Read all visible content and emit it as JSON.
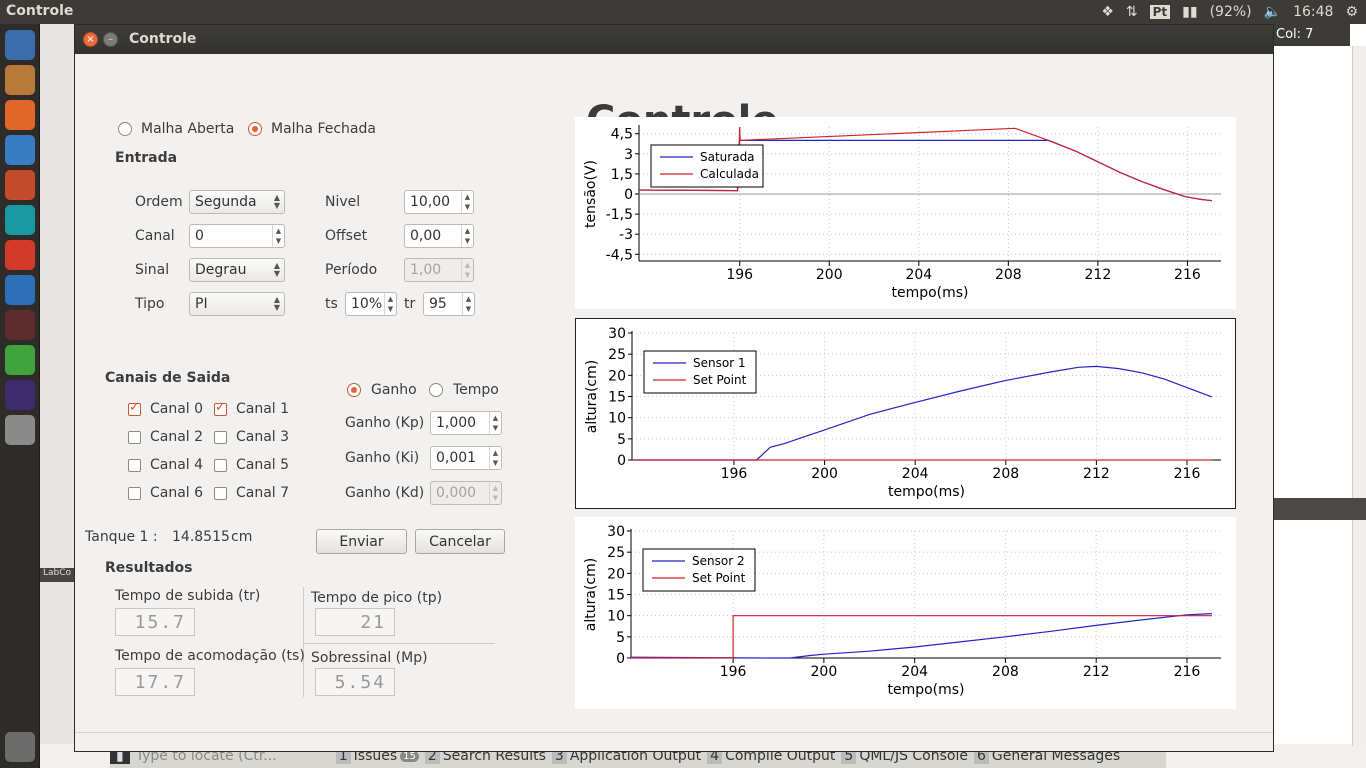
{
  "topbar": {
    "app_title": "Controle",
    "keyboard": "Pt",
    "battery": "(92%)",
    "clock": "16:48"
  },
  "bg": {
    "col_indicator": "Col: 7",
    "launcher_label": "LabCo"
  },
  "bottom_panel": {
    "locate_placeholder": "Type to locate (Ctr...",
    "tabs": [
      {
        "num": "1",
        "label": "Issues",
        "badge": "15"
      },
      {
        "num": "2",
        "label": "Search Results"
      },
      {
        "num": "3",
        "label": "Application Output"
      },
      {
        "num": "4",
        "label": "Compile Output"
      },
      {
        "num": "5",
        "label": "QML/JS Console"
      },
      {
        "num": "6",
        "label": "General Messages"
      }
    ]
  },
  "window": {
    "title": "Controle",
    "close_glyph": "×",
    "min_glyph": "–"
  },
  "form": {
    "big_title": "Controle",
    "mode_open": "Malha Aberta",
    "mode_closed": "Malha Fechada",
    "entrada": "Entrada",
    "ordem_label": "Ordem",
    "ordem_value": "Segunda",
    "canal_label": "Canal",
    "canal_value": "0",
    "sinal_label": "Sinal",
    "sinal_value": "Degrau",
    "tipo_label": "Tipo",
    "tipo_value": "PI",
    "nivel_label": "Nivel",
    "nivel_value": "10,00",
    "offset_label": "Offset",
    "offset_value": "0,00",
    "periodo_label": "Período",
    "periodo_value": "1,00",
    "ts_label": "ts",
    "ts_value": "10%",
    "tr_label": "tr",
    "tr_value": "95",
    "canais_title": "Canais de Saida",
    "canais": [
      "Canal 0",
      "Canal 1",
      "Canal 2",
      "Canal 3",
      "Canal 4",
      "Canal 5",
      "Canal 6",
      "Canal 7"
    ],
    "ganho_radio": "Ganho",
    "tempo_radio": "Tempo",
    "kp_label": "Ganho (Kp)",
    "kp_value": "1,000",
    "ki_label": "Ganho (Ki)",
    "ki_value": "0,001",
    "kd_label": "Ganho (Kd)",
    "kd_value": "0,000",
    "tanque_label": "Tanque 1 :",
    "tanque_value": "14.8515",
    "tanque_unit": "cm",
    "enviar": "Enviar",
    "cancelar": "Cancelar",
    "resultados": "Resultados",
    "tr_res_label": "Tempo de subida (tr)",
    "tr_res_value": "15.7",
    "tp_res_label": "Tempo de pico (tp)",
    "tp_res_value": "21",
    "ts_res_label": "Tempo de acomodação (ts)",
    "ts_res_value": "17.7",
    "mp_res_label": "Sobressinal (Mp)",
    "mp_res_value": "5.54"
  },
  "chart_data": [
    {
      "type": "line",
      "xlabel": "tempo(ms)",
      "ylabel": "tensão(V)",
      "xlim": [
        191.5,
        217.5
      ],
      "ylim": [
        -5,
        5
      ],
      "xticks": [
        196,
        200,
        204,
        208,
        212,
        216
      ],
      "yticks": [
        -4.5,
        -3,
        -1.5,
        0,
        1.5,
        3,
        4.5
      ],
      "ytick_labels": [
        "-4,5",
        "-3",
        "-1,5",
        "0",
        "1,5",
        "3",
        "4,5"
      ],
      "legend_position": "top-left",
      "series": [
        {
          "name": "Saturada",
          "color": "#2424c8",
          "x": [
            191.5,
            195.9,
            196.0,
            209.8,
            211,
            212,
            213,
            214,
            215,
            215.9,
            216.6,
            217.1
          ],
          "y": [
            0.3,
            0.25,
            4.0,
            4.0,
            3.2,
            2.4,
            1.6,
            0.9,
            0.3,
            -0.2,
            -0.4,
            -0.5
          ]
        },
        {
          "name": "Calculada",
          "color": "#cc2233",
          "x": [
            191.5,
            195.9,
            196.0,
            196.02,
            208.3,
            209.8,
            211,
            212,
            213,
            214,
            215,
            215.9,
            216.6,
            217.1
          ],
          "y": [
            0.3,
            0.25,
            5.0,
            4.0,
            4.9,
            4.0,
            3.2,
            2.4,
            1.6,
            0.9,
            0.3,
            -0.2,
            -0.4,
            -0.5
          ]
        }
      ]
    },
    {
      "type": "line",
      "xlabel": "tempo(ms)",
      "ylabel": "altura(cm)",
      "xlim": [
        191.5,
        217.5
      ],
      "ylim": [
        0,
        30
      ],
      "xticks": [
        196,
        200,
        204,
        208,
        212,
        216
      ],
      "yticks": [
        0,
        5,
        10,
        15,
        20,
        25,
        30
      ],
      "legend_position": "top-left",
      "series": [
        {
          "name": "Sensor 1",
          "color": "#2424c8",
          "x": [
            191.5,
            197.0,
            197.6,
            198.3,
            199,
            200,
            202,
            204,
            206,
            208,
            210,
            211.2,
            212,
            213,
            214,
            215,
            216,
            217.1
          ],
          "y": [
            0,
            0,
            3,
            4,
            5.3,
            7.1,
            10.8,
            13.6,
            16.3,
            18.8,
            20.8,
            21.9,
            22.1,
            21.6,
            20.6,
            19.1,
            17.1,
            14.9
          ]
        },
        {
          "name": "Set Point",
          "color": "#cc2233",
          "x": [
            191.5,
            217.1
          ],
          "y": [
            0,
            0
          ]
        }
      ]
    },
    {
      "type": "line",
      "xlabel": "tempo(ms)",
      "ylabel": "altura(cm)",
      "xlim": [
        191.5,
        217.5
      ],
      "ylim": [
        0,
        30
      ],
      "xticks": [
        196,
        200,
        204,
        208,
        212,
        216
      ],
      "yticks": [
        0,
        5,
        10,
        15,
        20,
        25,
        30
      ],
      "legend_position": "top-left",
      "series": [
        {
          "name": "Sensor 2",
          "color": "#2424c8",
          "x": [
            191.5,
            197.6,
            198.5,
            199.4,
            200,
            202,
            204,
            206,
            208,
            210,
            212,
            214,
            216,
            217.1
          ],
          "y": [
            0.2,
            0,
            0,
            0.6,
            0.9,
            1.6,
            2.6,
            3.8,
            5.0,
            6.3,
            7.7,
            9.0,
            10.2,
            10.5
          ]
        },
        {
          "name": "Set Point",
          "color": "#cc2233",
          "x": [
            191.5,
            196.0,
            196.0,
            217.1
          ],
          "y": [
            0,
            0,
            10,
            10
          ]
        }
      ]
    }
  ]
}
